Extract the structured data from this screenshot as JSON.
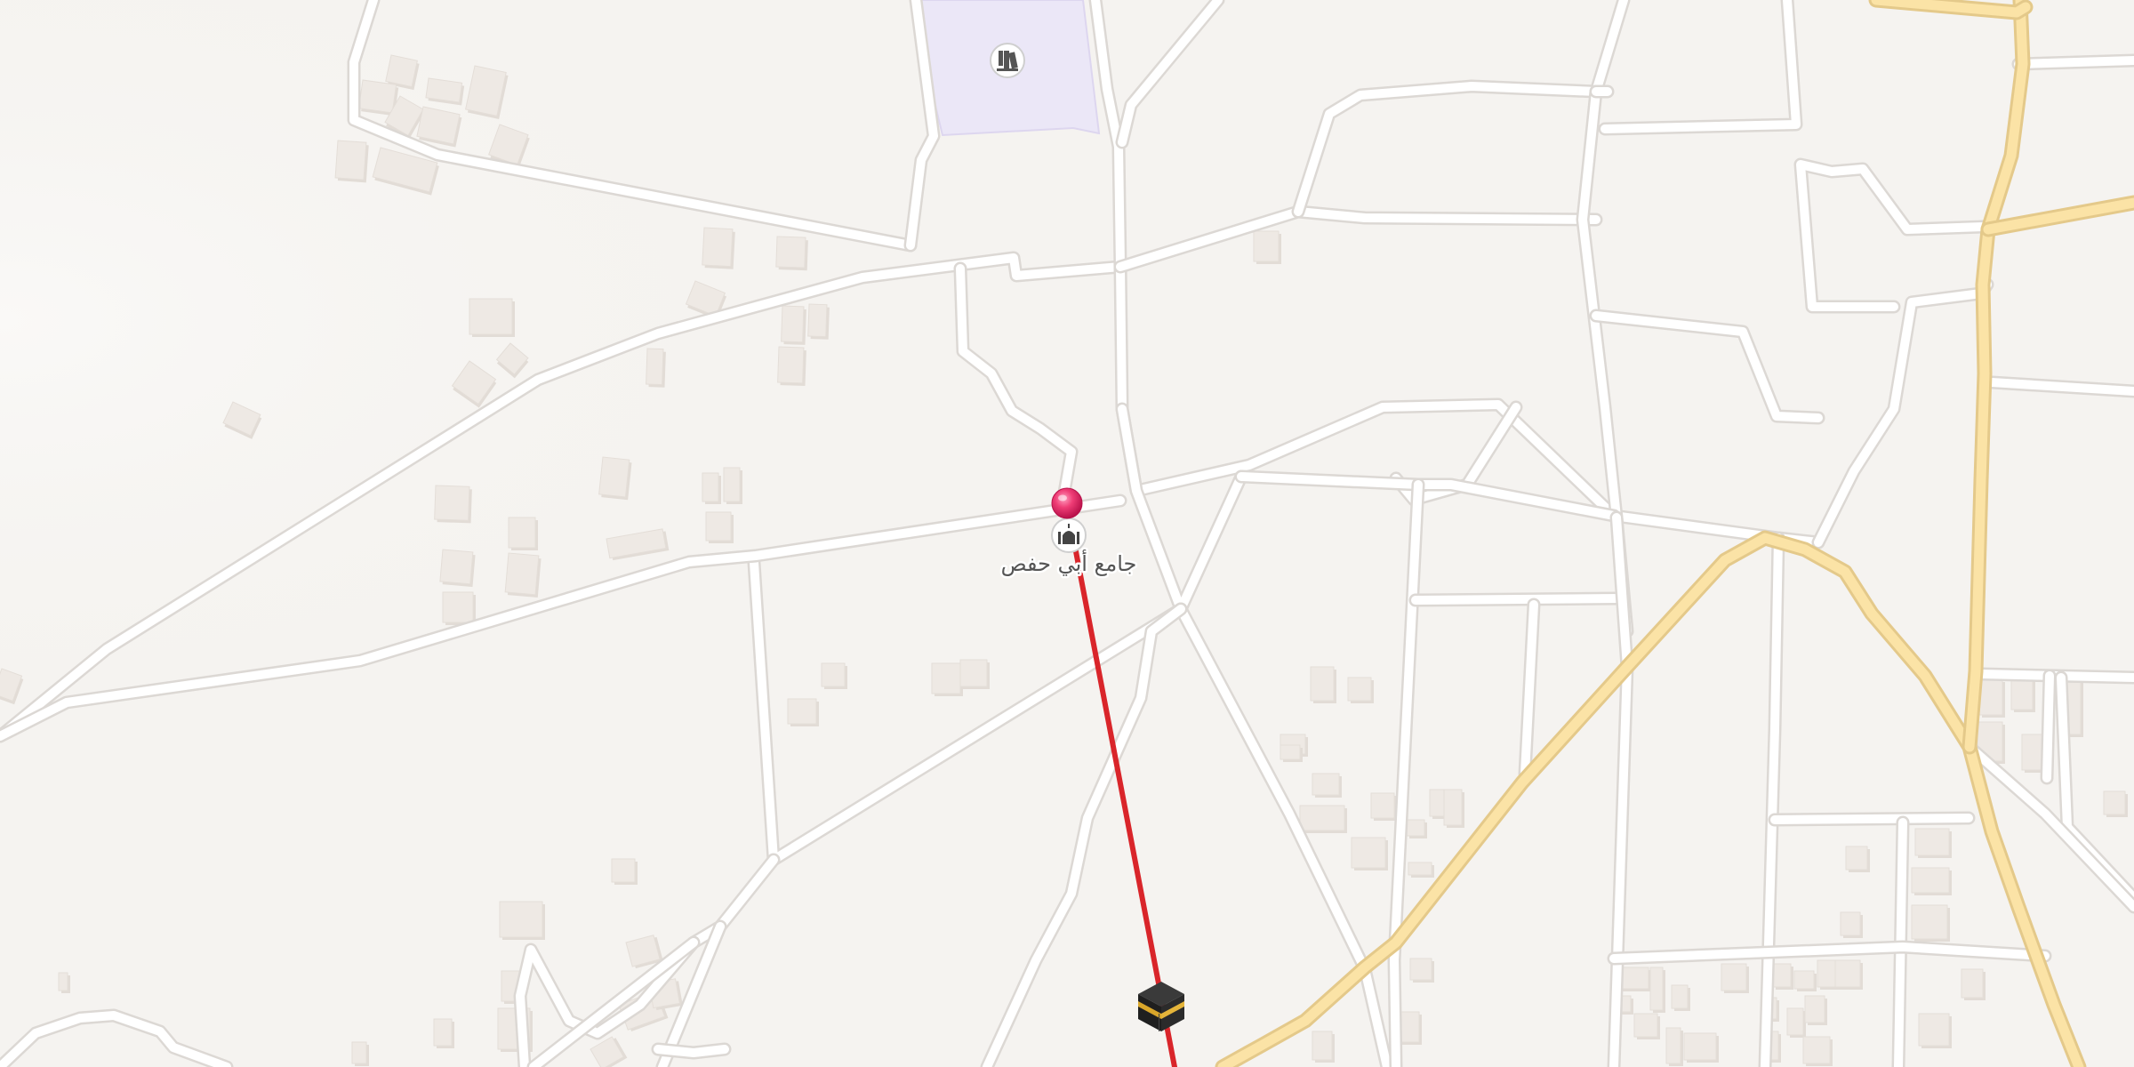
{
  "map": {
    "poi_mosque_label": "جامع أبي حفص",
    "icons": {
      "pin": "location-pin-icon",
      "mosque": "mosque-icon",
      "library": "library-icon",
      "kaaba": "kaaba-icon"
    },
    "colors": {
      "background": "#f5f3f0",
      "road": "#ffffff",
      "major_road": "#fbe3a6",
      "qibla_line": "#d9252a",
      "pin": "#e8336b",
      "school_area": "#ebe7f7"
    }
  }
}
